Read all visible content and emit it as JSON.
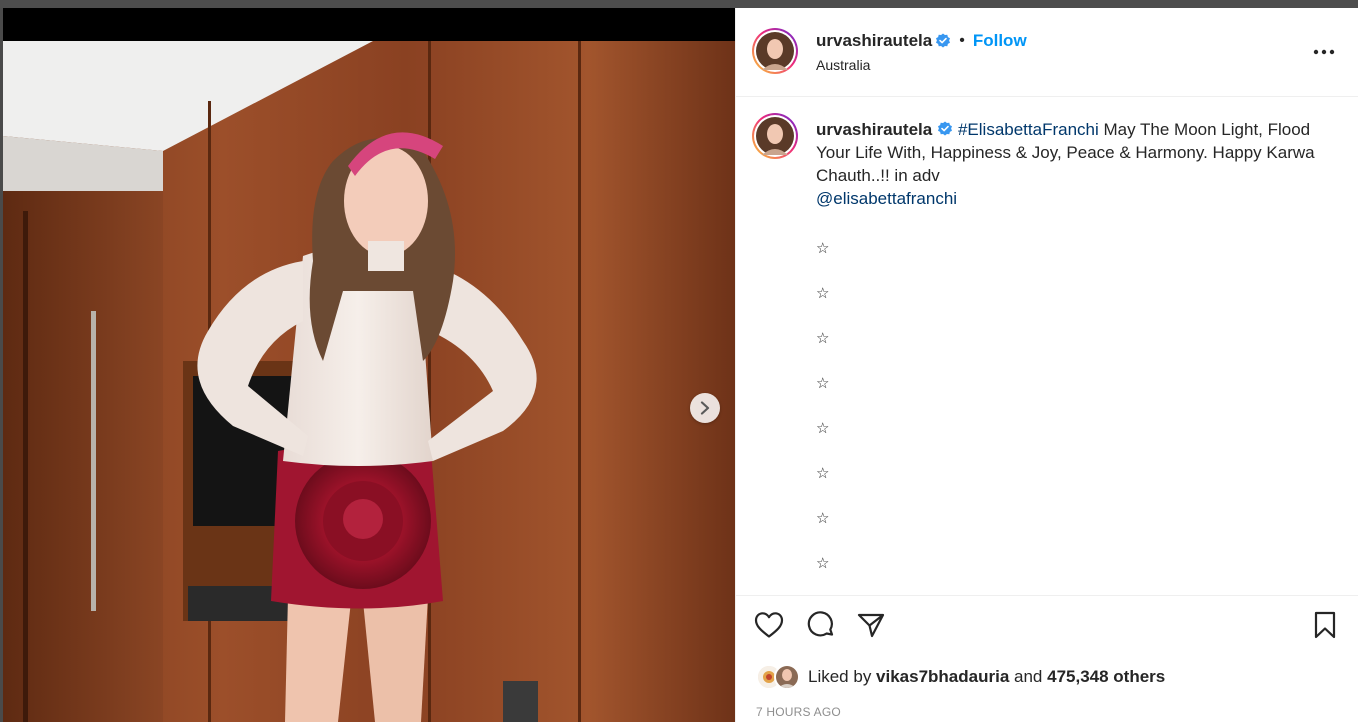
{
  "post": {
    "username": "urvashirautela",
    "follow_label": "Follow",
    "separator": "•",
    "location": "Australia",
    "icons": {
      "verified": "verified-badge-icon",
      "more": "more-options-icon",
      "next": "chevron-right-icon",
      "like": "heart-icon",
      "comment": "comment-icon",
      "share": "share-icon",
      "save": "bookmark-icon"
    }
  },
  "caption": {
    "username": "urvashirautela",
    "hashtag": "#ElisabettaFranchi",
    "text": " May The Moon Light, Flood Your Life With, Happiness & Joy, Peace & Harmony. Happy Karwa Chauth..!! in adv",
    "mention": "@elisabettafranchi",
    "stars": [
      "☆",
      "☆",
      "☆",
      "☆",
      "☆",
      "☆",
      "☆",
      "☆"
    ]
  },
  "likes": {
    "prefix": "Liked by ",
    "liker": "vikas7bhadauria",
    "joiner": " and ",
    "count_text": "475,348 others"
  },
  "time_text": "7 HOURS AGO",
  "colors": {
    "accent_blue": "#0095f6",
    "link_blue": "#00376b",
    "text": "#262626",
    "muted": "#8e8e8e",
    "verified_blue": "#3897f0"
  }
}
